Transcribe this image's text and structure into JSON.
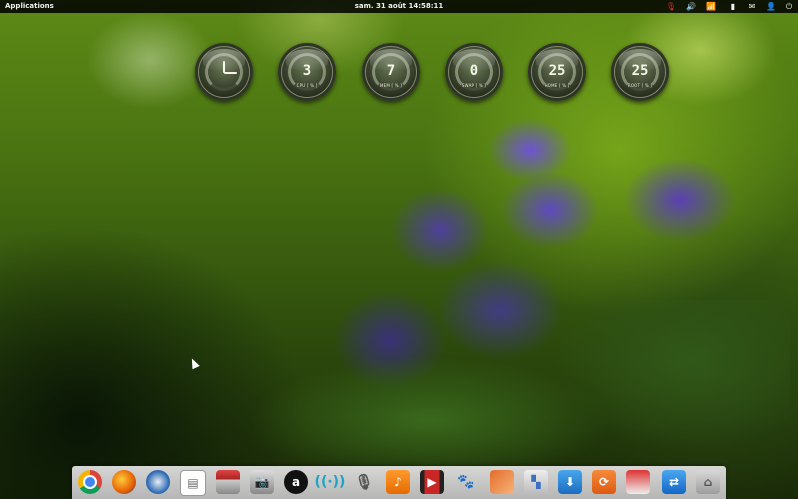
{
  "top_panel": {
    "applications_label": "Applications",
    "datetime": "sam. 31 août 14:58:11",
    "tray": {
      "mic_icon": "🎙",
      "volume_icon": "🔊",
      "wifi_icon": "📶",
      "battery_icon": "▮",
      "mail_icon": "✉",
      "user_icon": "👤",
      "power_icon": "⏻"
    }
  },
  "gauges": {
    "cpu": {
      "value": "3",
      "label": "CPU [ % ]"
    },
    "mem": {
      "value": "7",
      "label": "MEM [ % ]"
    },
    "swap": {
      "value": "0",
      "label": "SWAP [ % ]"
    },
    "home": {
      "value": "25",
      "label": "HOME [ % ]"
    },
    "root": {
      "value": "25",
      "label": "ROOT [ % ]"
    }
  },
  "dock": {
    "amazon_glyph": "a",
    "wifi_glyph": "((·))",
    "mic_glyph": "🎙",
    "music_glyph": "♪",
    "video_glyph": "▶",
    "gimp_glyph": "🐾",
    "switch_glyph": "▚",
    "download_glyph": "⬇",
    "update_glyph": "⟳",
    "teamviewer_glyph": "⇄",
    "home_glyph": "⌂",
    "camera_glyph": "📷",
    "files_glyph": "▤"
  },
  "colors": {
    "panel_bg": "#000000",
    "wallpaper_green": "#4a7412",
    "flower_purple": "#5f46c8"
  }
}
